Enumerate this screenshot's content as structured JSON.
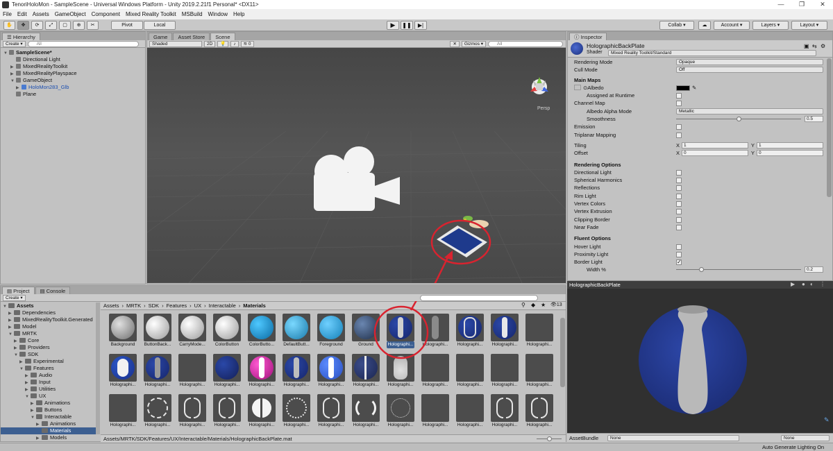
{
  "window": {
    "title": "TenoriHoloMon - SampleScene - Universal Windows Platform - Unity 2019.2.21f1 Personal* <DX11>",
    "minimize": "—",
    "maximize": "❐",
    "close": "✕"
  },
  "menu": [
    "File",
    "Edit",
    "Assets",
    "GameObject",
    "Component",
    "Mixed Reality Toolkit",
    "MSBuild",
    "Window",
    "Help"
  ],
  "toolbar": {
    "pivot": "Pivot",
    "local": "Local",
    "collab": "Collab ▾",
    "account": "Account",
    "layers": "Layers",
    "layout": "Layout"
  },
  "hierarchy": {
    "tab": "Hierarchy",
    "create": "Create",
    "search_placeholder": "All",
    "scene": "SampleScene*",
    "items": [
      "Directional Light",
      "MixedRealityToolkit",
      "MixedRealityPlayspace",
      "GameObject",
      "HoloMon283_Glb",
      "Plane"
    ]
  },
  "scene_view": {
    "tabs": [
      "Game",
      "Asset Store",
      "Scene"
    ],
    "shading": "Shaded",
    "mode2d": "2D",
    "fx_count": "0",
    "gizmos": "Gizmos",
    "search_placeholder": "All",
    "persp": "Persp"
  },
  "inspector": {
    "tab": "Inspector",
    "material_name": "HolographicBackPlate",
    "shader_label": "Shader",
    "shader_value": "Mixed Reality Toolkit/Standard",
    "rendering_mode_label": "Rendering Mode",
    "rendering_mode_value": "Opaque",
    "cull_mode_label": "Cull Mode",
    "cull_mode_value": "Off",
    "main_maps": "Main Maps",
    "albedo": "Albedo",
    "albedo_color": "#000000",
    "assigned_runtime": "Assigned at Runtime",
    "channel_map": "Channel Map",
    "albedo_alpha_mode": "Albedo Alpha Mode",
    "albedo_alpha_value": "Metallic",
    "smoothness": "Smoothness",
    "smoothness_value": "0.5",
    "smoothness_fraction": 0.5,
    "emission": "Emission",
    "triplanar": "Triplanar Mapping",
    "tiling": "Tiling",
    "offset": "Offset",
    "tiling_x": "1",
    "tiling_y": "1",
    "offset_x": "0",
    "offset_y": "0",
    "x_label": "X",
    "y_label": "Y",
    "rendering_options": "Rendering Options",
    "ro_items": [
      "Directional Light",
      "Spherical Harmonics",
      "Reflections",
      "Rim Light",
      "Vertex Colors",
      "Vertex Extrusion",
      "Clipping Border",
      "Near Fade"
    ],
    "fluent_options": "Fluent Options",
    "fo_items": [
      "Hover Light",
      "Proximity Light",
      "Border Light"
    ],
    "width_label": "Width %",
    "width_value": "0.2",
    "width_fraction": 0.2
  },
  "preview": {
    "title": "HolographicBackPlate",
    "assetbundle_label": "AssetBundle",
    "assetbundle_value": "None",
    "variant_value": "None"
  },
  "project": {
    "tabs": [
      "Project",
      "Console"
    ],
    "create": "Create",
    "tree": [
      {
        "label": "Assets",
        "depth": 0,
        "bold": true
      },
      {
        "label": "Dependencies",
        "depth": 1
      },
      {
        "label": "MixedRealityToolkit.Generated",
        "depth": 1
      },
      {
        "label": "Model",
        "depth": 1
      },
      {
        "label": "MRTK",
        "depth": 1
      },
      {
        "label": "Core",
        "depth": 2
      },
      {
        "label": "Providers",
        "depth": 2
      },
      {
        "label": "SDK",
        "depth": 2
      },
      {
        "label": "Experimental",
        "depth": 3
      },
      {
        "label": "Features",
        "depth": 3
      },
      {
        "label": "Audio",
        "depth": 4
      },
      {
        "label": "Input",
        "depth": 4
      },
      {
        "label": "Utilities",
        "depth": 4
      },
      {
        "label": "UX",
        "depth": 4
      },
      {
        "label": "Animations",
        "depth": 5
      },
      {
        "label": "Buttons",
        "depth": 5
      },
      {
        "label": "Interactable",
        "depth": 5
      },
      {
        "label": "Animations",
        "depth": 6
      },
      {
        "label": "Materials",
        "depth": 6
      },
      {
        "label": "Models",
        "depth": 6
      }
    ],
    "breadcrumb": [
      "Assets",
      "MRTK",
      "SDK",
      "Features",
      "UX",
      "Interactable",
      "Materials"
    ],
    "breadcrumb_sep": "›",
    "icon_count": "13",
    "asset_labels_row1": [
      "Background",
      "ButtonBack...",
      "CarryMode...",
      "ColorButton",
      "ColorButto...",
      "DefaultButt...",
      "Foreground",
      "Ground",
      "Holographi...",
      "Holographi...",
      "Holographi...",
      "Holographi...",
      "Holographi..."
    ],
    "asset_labels_row2": [
      "Holographi...",
      "Holographi...",
      "Holographi...",
      "Holographi...",
      "Holographi...",
      "Holographi...",
      "Holographi...",
      "Holographi...",
      "Holographi...",
      "Holographi...",
      "Holographi...",
      "Holographi...",
      "Holographi..."
    ],
    "asset_labels_row3": [
      "Holographi...",
      "Holographi...",
      "Holographi...",
      "Holographi...",
      "Holographi...",
      "Holographi...",
      "Holographi...",
      "Holographi...",
      "Holographi...",
      "Holographi...",
      "Holographi...",
      "Holographi...",
      "Holographi..."
    ],
    "path": "Assets/MRTK/SDK/Features/UX/Interactable/Materials/HolographicBackPlate.mat"
  },
  "status": {
    "text": "Auto Generate Lighting On"
  },
  "colors": {
    "highlight_red": "#d9232f",
    "selection_blue": "#3c5f91",
    "sphere_blue": "#233a91"
  }
}
